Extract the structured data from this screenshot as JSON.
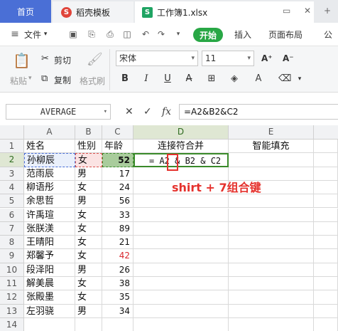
{
  "tabs": [
    {
      "label": "首页"
    },
    {
      "label": "稻壳模板",
      "icon": "docer-icon"
    },
    {
      "label": "工作簿1.xlsx",
      "icon": "sheet-icon"
    }
  ],
  "menu": {
    "file": "文件",
    "start": "开始",
    "insert": "插入",
    "page_layout": "页面布局",
    "more": "公"
  },
  "ribbon": {
    "paste": "粘贴",
    "cut": "剪切",
    "copy": "复制",
    "format_painter": "格式刷",
    "font_name": "宋体",
    "font_size": "11",
    "bold": "B",
    "italic": "I",
    "underline": "U"
  },
  "formula_bar": {
    "name_box": "AVERAGE",
    "fx": "fx",
    "formula": "=A2&B2&C2"
  },
  "columns": [
    "A",
    "B",
    "C",
    "D",
    "E"
  ],
  "rows": [
    "1",
    "2",
    "3",
    "4",
    "5",
    "6",
    "7",
    "8",
    "9",
    "10",
    "11",
    "12",
    "13",
    "14"
  ],
  "header_row": {
    "a": "姓名",
    "b": "性别",
    "c": "年龄",
    "d": "连接符合并",
    "e": "智能填充"
  },
  "data_rows": [
    {
      "name": "孙柳辰",
      "gender": "女",
      "age": "52"
    },
    {
      "name": "范雨辰",
      "gender": "男",
      "age": "17"
    },
    {
      "name": "柳语彤",
      "gender": "女",
      "age": "24"
    },
    {
      "name": "余思哲",
      "gender": "男",
      "age": "56"
    },
    {
      "name": "许禹瑄",
      "gender": "女",
      "age": "33"
    },
    {
      "name": "张朕渼",
      "gender": "女",
      "age": "89"
    },
    {
      "name": "王晴阳",
      "gender": "女",
      "age": "21"
    },
    {
      "name": "郑馨予",
      "gender": "女",
      "age": "42"
    },
    {
      "name": "段泽阳",
      "gender": "男",
      "age": "26"
    },
    {
      "name": "解美晨",
      "gender": "女",
      "age": "38"
    },
    {
      "name": "张殿墨",
      "gender": "女",
      "age": "35"
    },
    {
      "name": "左羽骁",
      "gender": "男",
      "age": "34"
    }
  ],
  "editing_cell": {
    "text": "= A2 & B2 & C2"
  },
  "annotation": "shirt + 7组合键",
  "colors": {
    "accent_green": "#28a745",
    "annotation_red": "#e5322d",
    "tab_blue": "#4a6fd6"
  }
}
